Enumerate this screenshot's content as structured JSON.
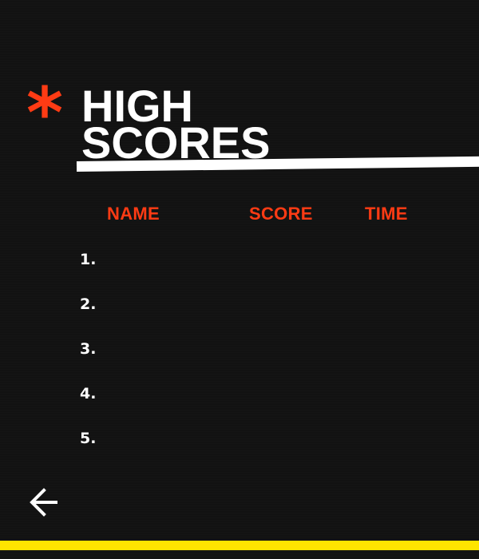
{
  "title": {
    "decoration_icon": "asterisk-icon",
    "decoration_glyph": "*",
    "line1": "HIGH",
    "line2": "SCORES"
  },
  "table": {
    "headers": {
      "name": "NAME",
      "score": "SCORE",
      "time": "TIME"
    },
    "rows": [
      {
        "rank": "1.",
        "name": "",
        "score": "",
        "time": ""
      },
      {
        "rank": "2.",
        "name": "",
        "score": "",
        "time": ""
      },
      {
        "rank": "3.",
        "name": "",
        "score": "",
        "time": ""
      },
      {
        "rank": "4.",
        "name": "",
        "score": "",
        "time": ""
      },
      {
        "rank": "5.",
        "name": "",
        "score": "",
        "time": ""
      }
    ]
  },
  "navigation": {
    "back_icon": "arrow-left-icon"
  },
  "colors": {
    "background": "#121212",
    "accent": "#ff3b14",
    "text": "#ffffff",
    "bottom_bar": "#ffe500"
  }
}
